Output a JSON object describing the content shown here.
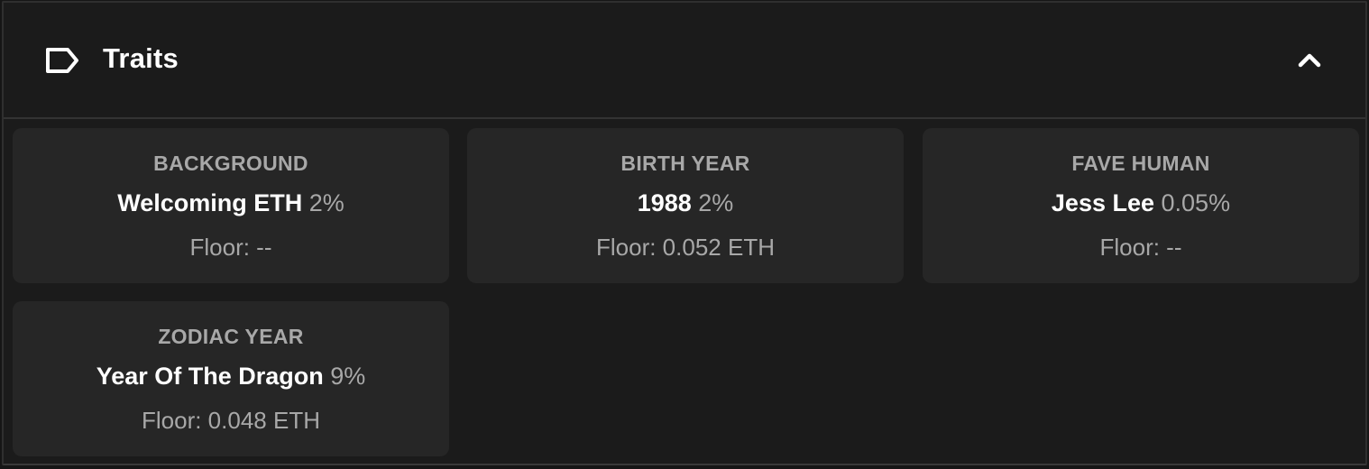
{
  "panel": {
    "title": "Traits",
    "icons": {
      "title_icon": "tag-icon",
      "toggle_icon": "chevron-up-icon"
    },
    "expanded": true
  },
  "traits": [
    {
      "type": "BACKGROUND",
      "value": "Welcoming ETH",
      "percent": "2%",
      "floor": "Floor: --"
    },
    {
      "type": "BIRTH YEAR",
      "value": "1988",
      "percent": "2%",
      "floor": "Floor: 0.052 ETH"
    },
    {
      "type": "FAVE HUMAN",
      "value": "Jess Lee",
      "percent": "0.05%",
      "floor": "Floor: --"
    },
    {
      "type": "ZODIAC YEAR",
      "value": "Year Of The Dragon",
      "percent": "9%",
      "floor": "Floor: 0.048 ETH"
    }
  ],
  "colors": {
    "background": "#1b1b1b",
    "card": "#262626",
    "text_primary": "#ffffff",
    "text_secondary": "#a8a8a8"
  }
}
